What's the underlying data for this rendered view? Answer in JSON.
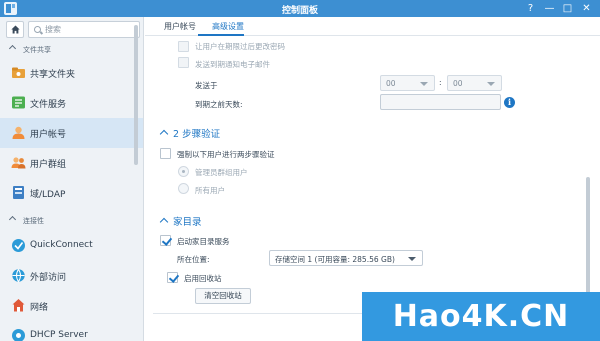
{
  "window": {
    "title": "控制面板",
    "controls": [
      "?",
      "—",
      "□",
      "✕"
    ]
  },
  "sidebar": {
    "search": {
      "placeholder": "搜索"
    },
    "sections": [
      {
        "label": "文件共享",
        "items": [
          {
            "label": "共享文件夹",
            "icon": "shared-folder-icon",
            "color": "#e8a13a"
          },
          {
            "label": "文件服务",
            "icon": "file-service-icon",
            "color": "#4caf50"
          },
          {
            "label": "用户帐号",
            "icon": "user-icon",
            "color": "#f08c3a",
            "active": true
          },
          {
            "label": "用户群组",
            "icon": "user-group-icon",
            "color": "#f08c3a"
          },
          {
            "label": "域/LDAP",
            "icon": "ldap-icon",
            "color": "#3d7fc4"
          }
        ]
      },
      {
        "label": "连接性",
        "items": [
          {
            "label": "QuickConnect",
            "icon": "quickconnect-icon",
            "color": "#2b9bd8"
          },
          {
            "label": "外部访问",
            "icon": "external-access-icon",
            "color": "#2b9bd8"
          },
          {
            "label": "网络",
            "icon": "network-icon",
            "color": "#e05a3a"
          },
          {
            "label": "DHCP Server",
            "icon": "dhcp-server-icon",
            "color": "#2b9bd8"
          }
        ]
      }
    ]
  },
  "tabs": [
    {
      "label": "用户帐号",
      "active": false
    },
    {
      "label": "高级设置",
      "active": true
    }
  ],
  "password_expiry": {
    "partial_label": "让用户在期限过后更改密码",
    "email_notice_label": "发送到期通知电子邮件",
    "send_at_label": "发送于",
    "hour_value": "00",
    "minute_value": "00",
    "separator": ":",
    "days_before_label": "到期之前天数:",
    "info_glyph": "i"
  },
  "two_step": {
    "title": "2 步骤验证",
    "enforce_label": "强制以下用户进行两步骤验证",
    "radio_admins": "管理员群组用户",
    "radio_all": "所有用户"
  },
  "home": {
    "title": "家目录",
    "enable_label": "启动家目录服务",
    "location_label": "所在位置:",
    "location_value": "存储空间 1 (可用容量:  285.56 GB)",
    "recycle_label": "启用回收站",
    "empty_recycle_button": "清空回收站"
  },
  "watermark": {
    "text": "Hao4K.CN"
  },
  "colors": {
    "accent": "#1e76c4",
    "titlebar": "#3d8fd2",
    "sidebar_bg": "#eef2f6"
  }
}
